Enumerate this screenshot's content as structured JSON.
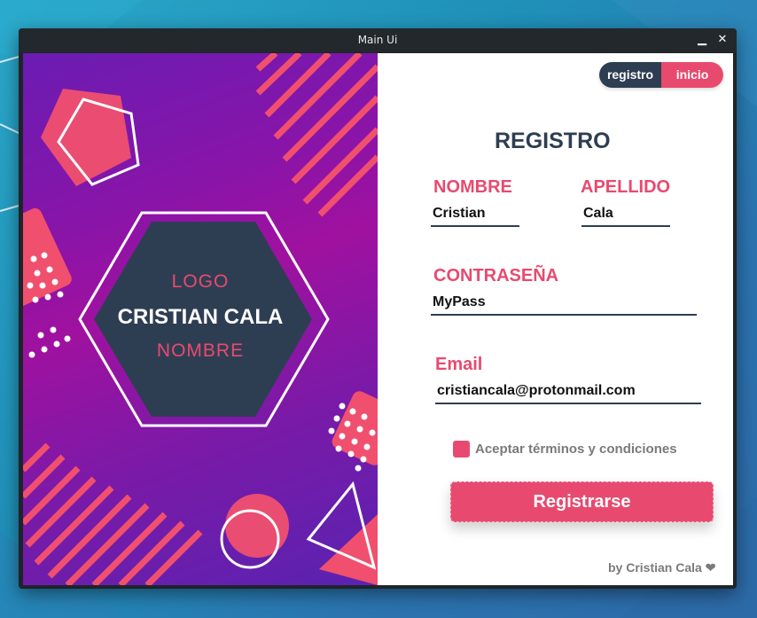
{
  "window": {
    "title": "Main Ui",
    "minimize_icon": "minimize-icon",
    "close_icon": "close-icon"
  },
  "left_panel": {
    "logo_label": "LOGO",
    "brand_name": "CRISTIAN CALA",
    "name_label": "NOMBRE",
    "colors": {
      "accent": "#e84a6f",
      "hexagon": "#2e3e52",
      "gradient_mid": "#a0119f"
    }
  },
  "toggle": {
    "registro": "registro",
    "inicio": "inicio"
  },
  "form": {
    "heading": "REGISTRO",
    "nombre_label": "NOMBRE",
    "nombre_value": "Cristian",
    "apellido_label": "APELLIDO",
    "apellido_value": "Cala",
    "password_label": "CONTRASEÑA",
    "password_value": "MyPass",
    "email_label": "Email",
    "email_value": "cristiancala@protonmail.com",
    "terms_label": "Aceptar términos y condiciones",
    "terms_checked": true,
    "submit_label": "Registrarse"
  },
  "footer": {
    "credit": "by Cristian Cala ❤"
  },
  "colors": {
    "primary": "#2e3e52",
    "accent": "#e84a6f"
  }
}
